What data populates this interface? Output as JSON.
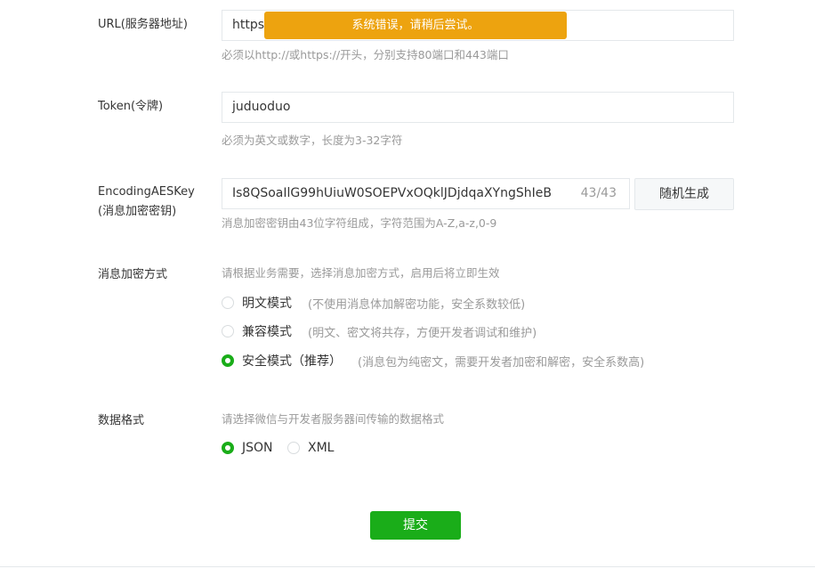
{
  "toast": {
    "message": "系统错误，请稍后尝试。"
  },
  "url": {
    "label": "URL(服务器地址)",
    "value": "https:",
    "hint": "必须以http://或https://开头，分别支持80端口和443端口"
  },
  "token": {
    "label": "Token(令牌)",
    "value": "juduoduo",
    "hint": "必须为英文或数字，长度为3-32字符"
  },
  "aeskey": {
    "label_line1": "EncodingAESKey",
    "label_line2": "(消息加密密钥)",
    "value": "Is8QSoaIlG99hUiuW0SOEPVxOQklJDjdqaXYngShIeB",
    "counter": "43/43",
    "generate_label": "随机生成",
    "hint": "消息加密密钥由43位字符组成，字符范围为A-Z,a-z,0-9"
  },
  "encryption": {
    "label": "消息加密方式",
    "hint": "请根据业务需要，选择消息加密方式，启用后将立即生效",
    "options": [
      {
        "label": "明文模式",
        "desc": "(不使用消息体加解密功能，安全系数较低)",
        "checked": false
      },
      {
        "label": "兼容模式",
        "desc": "(明文、密文将共存，方便开发者调试和维护)",
        "checked": false
      },
      {
        "label": "安全模式（推荐）",
        "desc": "(消息包为纯密文，需要开发者加密和解密，安全系数高)",
        "checked": true
      }
    ]
  },
  "format": {
    "label": "数据格式",
    "hint": "请选择微信与开发者服务器间传输的数据格式",
    "options": [
      {
        "label": "JSON",
        "checked": true
      },
      {
        "label": "XML",
        "checked": false
      }
    ]
  },
  "submit": {
    "label": "提交"
  },
  "colors": {
    "primary_green": "#1aad19",
    "toast_orange": "#eda30f"
  }
}
